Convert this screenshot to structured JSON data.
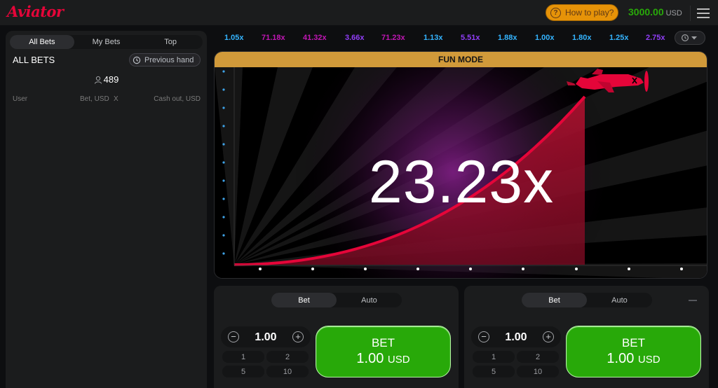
{
  "app": {
    "logo": "Aviator",
    "how_to_play": "How to play?",
    "balance": "3000.00",
    "currency": "USD"
  },
  "bets_panel": {
    "tabs": [
      "All Bets",
      "My Bets",
      "Top"
    ],
    "heading": "ALL BETS",
    "previous_hand": "Previous hand",
    "user_count": "489",
    "columns": [
      "User",
      "Bet, USD",
      "X",
      "Cash out, USD"
    ]
  },
  "history": [
    {
      "value": "1.05x",
      "color": "#34b4ff"
    },
    {
      "value": "71.18x",
      "color": "#c017b4"
    },
    {
      "value": "41.32x",
      "color": "#c017b4"
    },
    {
      "value": "3.66x",
      "color": "#913ef8"
    },
    {
      "value": "71.23x",
      "color": "#c017b4"
    },
    {
      "value": "1.13x",
      "color": "#34b4ff"
    },
    {
      "value": "5.51x",
      "color": "#913ef8"
    },
    {
      "value": "1.88x",
      "color": "#34b4ff"
    },
    {
      "value": "1.00x",
      "color": "#34b4ff"
    },
    {
      "value": "1.80x",
      "color": "#34b4ff"
    },
    {
      "value": "1.25x",
      "color": "#34b4ff"
    },
    {
      "value": "2.75x",
      "color": "#913ef8"
    }
  ],
  "game": {
    "mode_banner": "FUN MODE",
    "multiplier": "23.23x",
    "curve_color": "#e50539"
  },
  "bet_panels": [
    {
      "tabs": [
        "Bet",
        "Auto"
      ],
      "stake": "1.00",
      "quick_amounts": [
        "1",
        "2",
        "5",
        "10"
      ],
      "button_label": "BET",
      "button_amount": "1.00",
      "button_currency": "USD",
      "has_remove": false
    },
    {
      "tabs": [
        "Bet",
        "Auto"
      ],
      "stake": "1.00",
      "quick_amounts": [
        "1",
        "2",
        "5",
        "10"
      ],
      "button_label": "BET",
      "button_amount": "1.00",
      "button_currency": "USD",
      "has_remove": true
    }
  ]
}
